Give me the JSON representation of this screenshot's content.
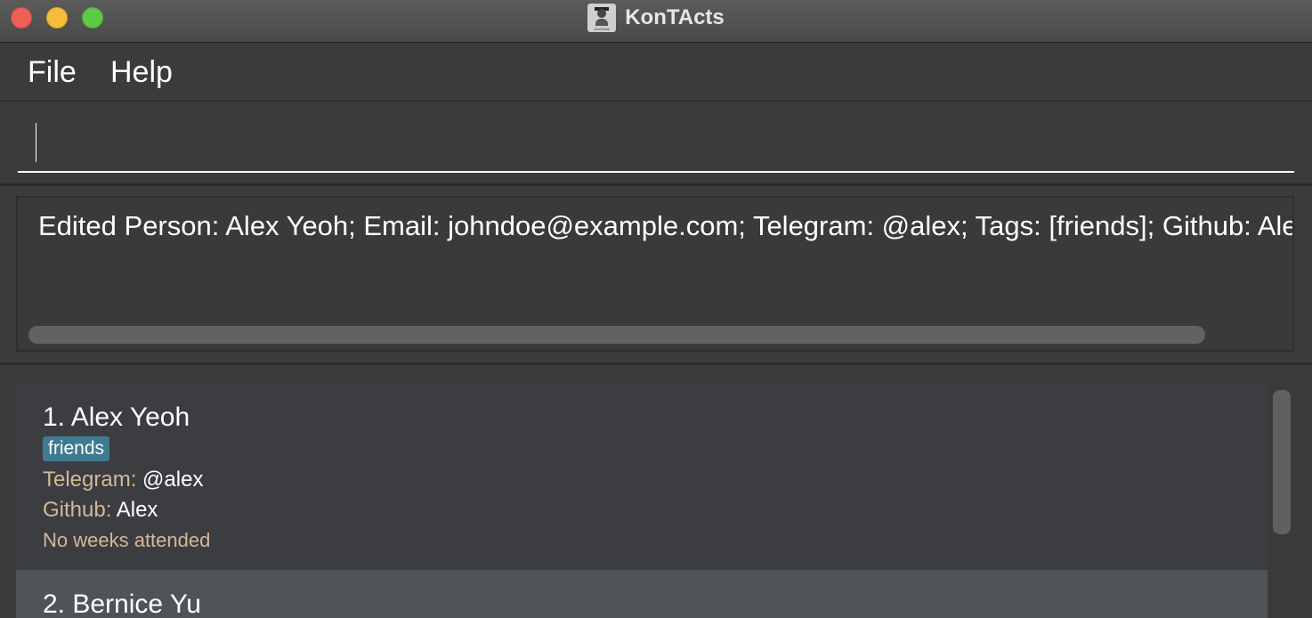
{
  "window": {
    "title": "KonTActs",
    "app_icon_label": "KonTActs"
  },
  "menu": {
    "items": [
      {
        "label": "File"
      },
      {
        "label": "Help"
      }
    ]
  },
  "command_box": {
    "value": "",
    "placeholder": ""
  },
  "result_display": {
    "text": "Edited Person: Alex Yeoh; Email: johndoe@example.com; Telegram: @alex; Tags: [friends]; Github: Alex"
  },
  "persons": [
    {
      "index_name": "1. Alex Yeoh",
      "tags": [
        "friends"
      ],
      "telegram_label": "Telegram:",
      "telegram": "@alex",
      "github_label": "Github:",
      "github": "Alex",
      "attendance": "No weeks attended"
    },
    {
      "index_name": "2. Bernice Yu"
    }
  ],
  "colors": {
    "background": "#3b3b3b",
    "tag": "#3e7b91",
    "field_label": "#d4b898",
    "selected_card": "#4f5458"
  }
}
